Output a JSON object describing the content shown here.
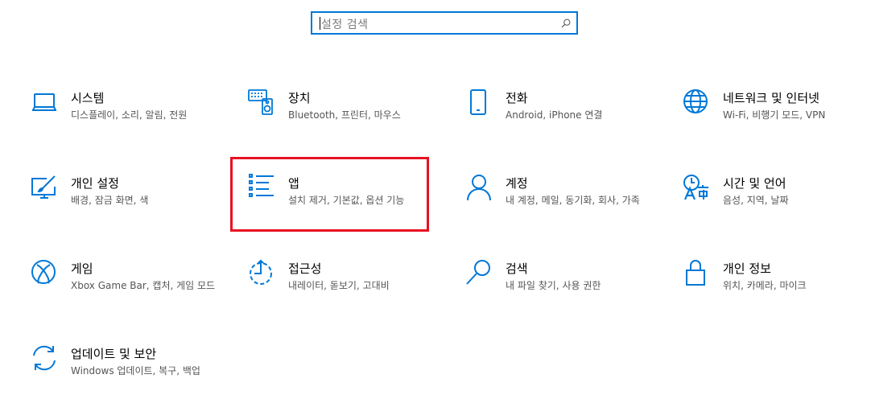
{
  "search": {
    "placeholder": "설정 검색"
  },
  "colors": {
    "accent": "#0078d7",
    "highlight": "#e81123"
  },
  "tiles": [
    {
      "icon": "laptop-icon",
      "title": "시스템",
      "desc": "디스플레이, 소리, 알림, 전원"
    },
    {
      "icon": "keyboard-speaker-icon",
      "title": "장치",
      "desc": "Bluetooth, 프린터, 마우스"
    },
    {
      "icon": "phone-icon",
      "title": "전화",
      "desc": "Android, iPhone 연결"
    },
    {
      "icon": "globe-icon",
      "title": "네트워크 및 인터넷",
      "desc": "Wi-Fi, 비행기 모드, VPN"
    },
    {
      "icon": "paint-monitor-icon",
      "title": "개인 설정",
      "desc": "배경, 잠금 화면, 색"
    },
    {
      "icon": "apps-list-icon",
      "title": "앱",
      "desc": "설치 제거, 기본값, 옵션 기능"
    },
    {
      "icon": "person-icon",
      "title": "계정",
      "desc": "내 계정, 메일, 동기화, 회사, 가족"
    },
    {
      "icon": "language-icon",
      "title": "시간 및 언어",
      "desc": "음성, 지역, 날짜"
    },
    {
      "icon": "xbox-icon",
      "title": "게임",
      "desc": "Xbox Game Bar, 캡처, 게임 모드"
    },
    {
      "icon": "ease-of-access-icon",
      "title": "접근성",
      "desc": "내레이터, 돋보기, 고대비"
    },
    {
      "icon": "search-icon",
      "title": "검색",
      "desc": "내 파일 찾기, 사용 권한"
    },
    {
      "icon": "lock-icon",
      "title": "개인 정보",
      "desc": "위치, 카메라, 마이크"
    },
    {
      "icon": "sync-icon",
      "title": "업데이트 및 보안",
      "desc": "Windows 업데이트, 복구, 백업"
    }
  ]
}
